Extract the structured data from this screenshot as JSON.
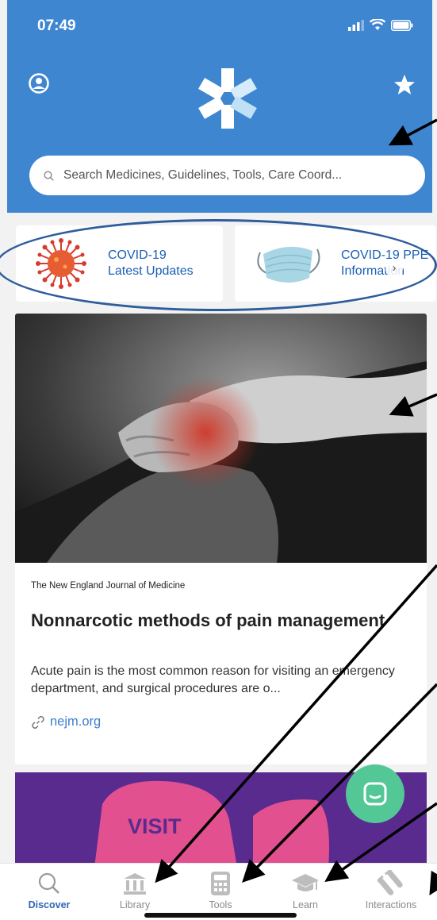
{
  "status_bar": {
    "time": "07:49"
  },
  "search": {
    "placeholder": "Search Medicines, Guidelines, Tools, Care Coord..."
  },
  "covid_cards": [
    {
      "line1": "COVID-19",
      "line2": "Latest Updates"
    },
    {
      "line1": "COVID-19 PPE",
      "line2": "Information"
    }
  ],
  "article": {
    "source": "The New England Journal of Medicine",
    "title": "Nonnarcotic methods of pain management",
    "summary": "Acute pain is the most common reason for visiting an emergency department, and surgical procedures are o...",
    "link": "nejm.org"
  },
  "promo": {
    "text": "VISIT"
  },
  "tabs": [
    {
      "label": "Discover",
      "icon": "search-icon",
      "active": true
    },
    {
      "label": "Library",
      "icon": "library-icon",
      "active": false
    },
    {
      "label": "Tools",
      "icon": "calculator-icon",
      "active": false
    },
    {
      "label": "Learn",
      "icon": "graduation-cap-icon",
      "active": false
    },
    {
      "label": "Interactions",
      "icon": "test-tubes-icon",
      "active": false
    }
  ],
  "colors": {
    "header": "#3f86d0",
    "accent": "#2e67b5",
    "chat": "#54c796",
    "promo": "#5a2b8f"
  }
}
